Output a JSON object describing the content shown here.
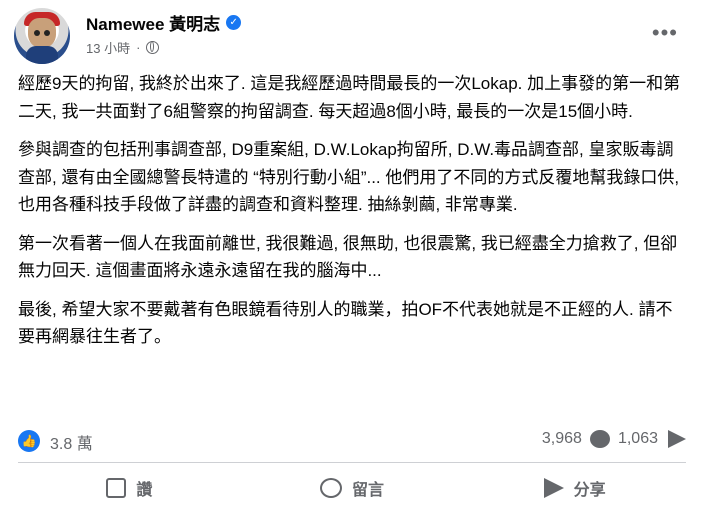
{
  "post": {
    "author": "Namewee 黃明志",
    "time": "13 小時",
    "separator": "·",
    "paragraphs": [
      "經歷9天的拘留, 我終於出來了. 這是我經歷過時間最長的一次Lokap. 加上事發的第一和第二天, 我一共面對了6組警察的拘留調查. 每天超過8個小時, 最長的一次是15個小時.",
      "參與調查的包括刑事調查部, D9重案組, D.W.Lokap拘留所, D.W.毒品調查部, 皇家販毒調查部, 還有由全國總警長特遣的 “特別行動小組”... 他們用了不同的方式反覆地幫我錄口供, 也用各種科技手段做了詳盡的調查和資料整理. 抽絲剝繭, 非常專業.",
      "第一次看著一個人在我面前離世, 我很難過, 很無助, 也很震驚, 我已經盡全力搶救了, 但卻無力回天. 這個畫面將永遠永遠留在我的腦海中...",
      "最後, 希望大家不要戴著有色眼鏡看待別人的職業，拍OF不代表她就是不正經的人. 請不要再網暴往生者了。"
    ]
  },
  "stats": {
    "likes": "3.8 萬",
    "comments": "3,968",
    "shares": "1,063"
  },
  "actions": {
    "like": "讚",
    "comment": "留言",
    "share": "分享"
  },
  "icons": {
    "verified": "verified-badge-icon",
    "globe": "globe-icon",
    "more": "more-dots-icon",
    "like": "thumbs-up-icon",
    "comment": "comment-bubble-icon",
    "share": "share-arrow-icon"
  },
  "colors": {
    "brand": "#1877f2",
    "muted": "#65676b",
    "text": "#050505"
  }
}
